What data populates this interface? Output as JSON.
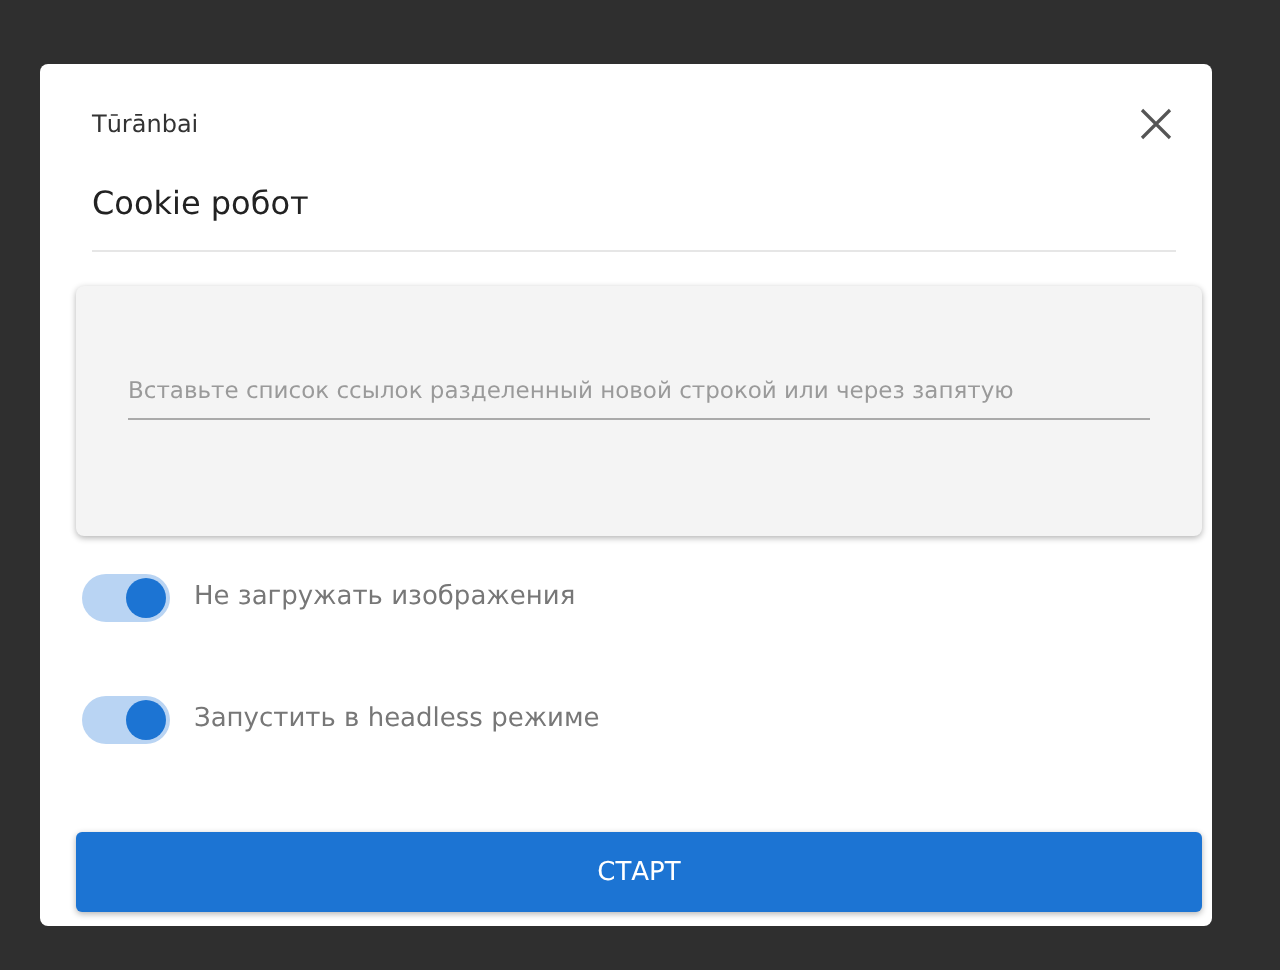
{
  "dialog": {
    "app_name": "Tūrānbai",
    "title": "Cookie робот"
  },
  "links_field": {
    "placeholder": "Вставьте список ссылок разделенный новой строкой или через запятую"
  },
  "options": [
    {
      "label": "Не загружать изображения",
      "on": true
    },
    {
      "label": "Запустить в headless режиме",
      "on": true
    }
  ],
  "start_button": {
    "label": "СТАРТ"
  }
}
